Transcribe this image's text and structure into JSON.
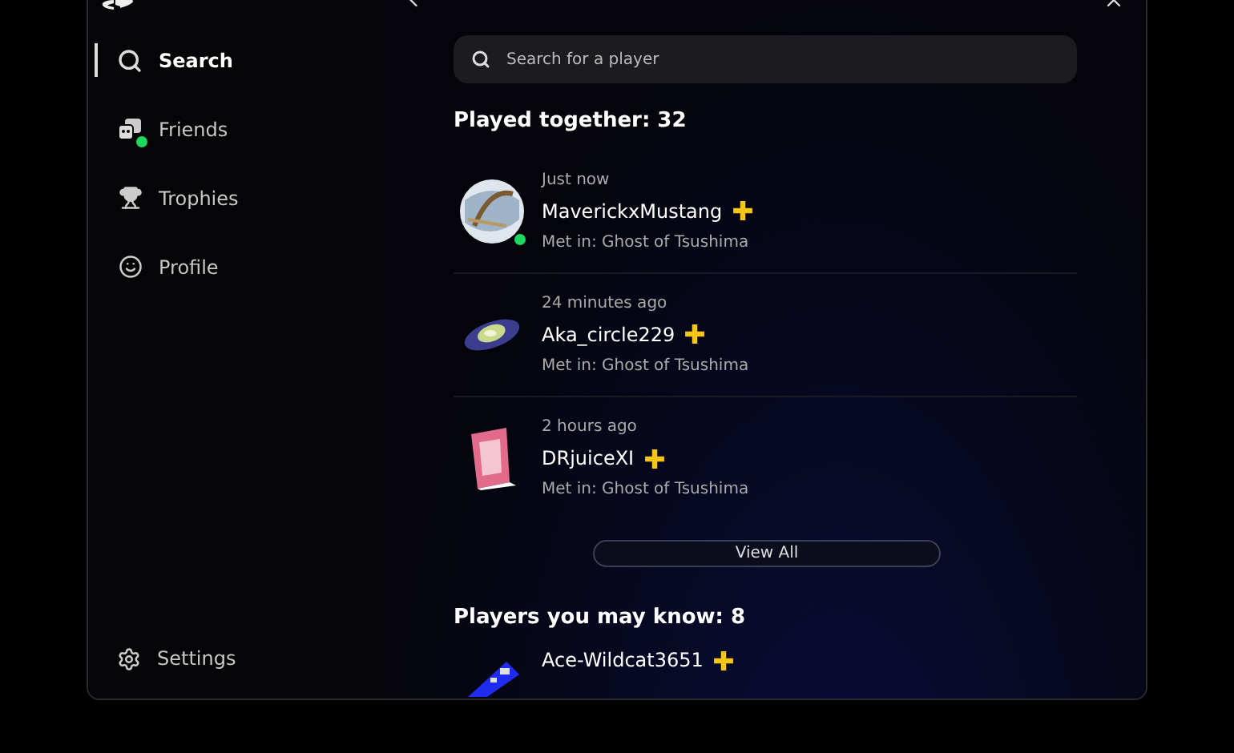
{
  "sidebar": {
    "items": [
      {
        "label": "Search",
        "selected": true,
        "badge": false
      },
      {
        "label": "Friends",
        "selected": false,
        "badge": true
      },
      {
        "label": "Trophies",
        "selected": false,
        "badge": false
      },
      {
        "label": "Profile",
        "selected": false,
        "badge": false
      }
    ],
    "settings": "Settings"
  },
  "search": {
    "placeholder": "Search for a player"
  },
  "played_together": {
    "title": "Played together: 32",
    "players": [
      {
        "time": "Just now",
        "name": "MaverickxMustang",
        "plus": true,
        "met_in": "Met in: Ghost of Tsushima",
        "online": true
      },
      {
        "time": "24 minutes ago",
        "name": "Aka_circle229",
        "plus": true,
        "met_in": "Met in: Ghost of Tsushima",
        "online": false
      },
      {
        "time": "2 hours ago",
        "name": "DRjuiceXI",
        "plus": true,
        "met_in": "Met in: Ghost of Tsushima",
        "online": false
      }
    ],
    "view_all": "View All"
  },
  "may_know": {
    "title": "Players you may know: 8",
    "players": [
      {
        "name": "Ace-Wildcat3651",
        "plus": true
      }
    ]
  }
}
